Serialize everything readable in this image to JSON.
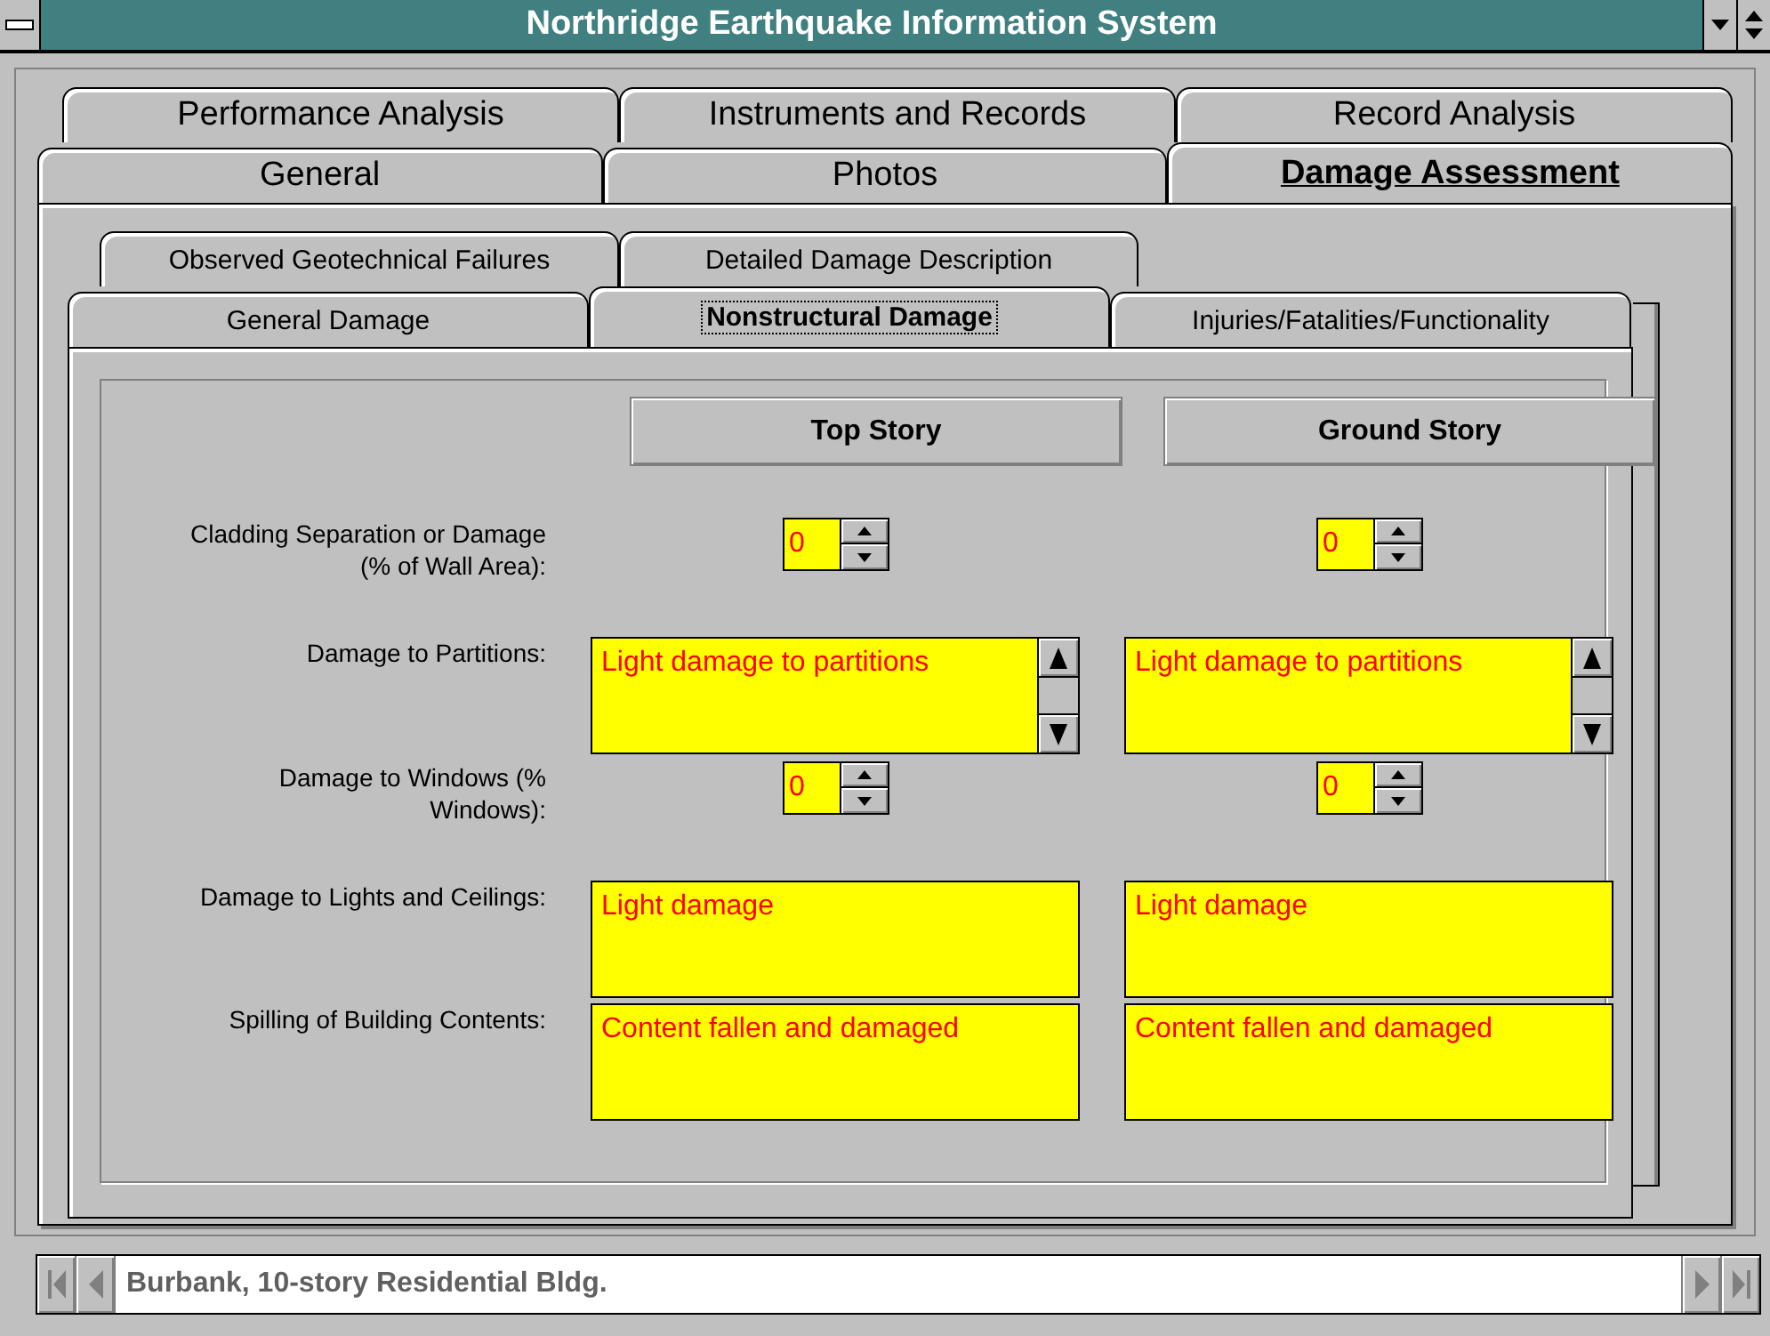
{
  "window": {
    "title": "Northridge Earthquake Information System"
  },
  "main_tabs": [
    [
      {
        "label": "Performance Analysis",
        "selected": false
      },
      {
        "label": "Instruments and Records",
        "selected": false
      },
      {
        "label": "Record Analysis",
        "selected": false
      }
    ],
    [
      {
        "label": "General",
        "selected": false
      },
      {
        "label": "Photos",
        "selected": false
      },
      {
        "label": "Damage Assessment",
        "selected": true
      }
    ]
  ],
  "sub_tabs": [
    [
      {
        "label": "Observed Geotechnical Failures",
        "selected": false
      },
      {
        "label": "Detailed Damage Description",
        "selected": false
      }
    ],
    [
      {
        "label": "General Damage",
        "selected": false
      },
      {
        "label": "Nonstructural Damage",
        "selected": true
      },
      {
        "label": "Injuries/Fatalities/Functionality",
        "selected": false
      }
    ]
  ],
  "columns": [
    "Top Story",
    "Ground Story"
  ],
  "rows": [
    {
      "label": "Cladding Separation or Damage (% of Wall Area):",
      "kind": "spin",
      "values": [
        "0",
        "0"
      ]
    },
    {
      "label": "Damage to Partitions:",
      "kind": "list",
      "values": [
        "Light damage to partitions",
        "Light damage to partitions"
      ]
    },
    {
      "label": "Damage to Windows (% Windows):",
      "kind": "spin",
      "values": [
        "0",
        "0"
      ]
    },
    {
      "label": "Damage to Lights and Ceilings:",
      "kind": "memo",
      "values": [
        "Light damage",
        "Light damage"
      ]
    },
    {
      "label": "Spilling of Building Contents:",
      "kind": "memo",
      "values": [
        "Content fallen and damaged",
        "Content fallen and damaged"
      ]
    }
  ],
  "record": {
    "value": "Burbank, 10-story Residential Bldg."
  }
}
